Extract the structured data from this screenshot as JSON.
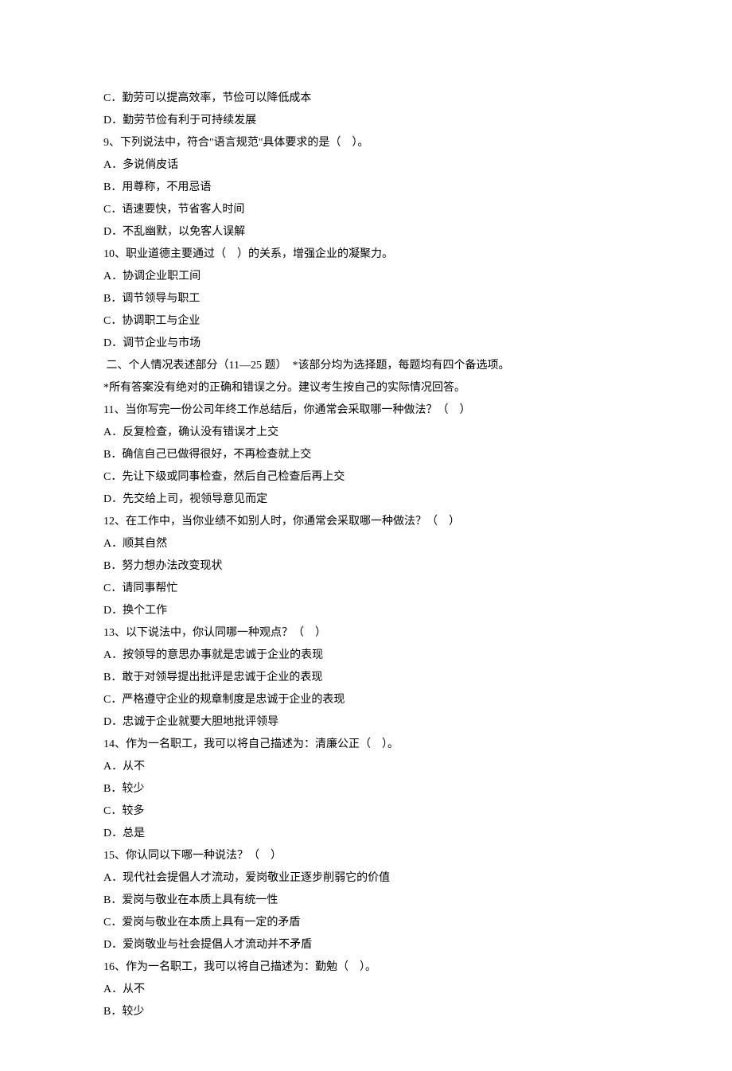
{
  "lines": [
    "C．勤劳可以提高效率，节俭可以降低成本",
    "D．勤劳节俭有利于可持续发展",
    "9、下列说法中，符合\"语言规范\"具体要求的是（    ）。",
    "A．多说俏皮话",
    "B．用尊称，不用忌语",
    "C．语速要快，节省客人时间",
    "D．不乱幽默，以免客人误解",
    "10、职业道德主要通过（    ）的关系，增强企业的凝聚力。",
    "A．协调企业职工间",
    "B．调节领导与职工",
    "C．协调职工与企业",
    "D．调节企业与市场",
    " 二、个人情况表述部分（11—25 题）  *该部分均为选择题，每题均有四个备选项。",
    "*所有答案没有绝对的正确和错误之分。建议考生按自己的实际情况回答。",
    "11、当你写完一份公司年终工作总结后，你通常会采取哪一种做法？（    ）",
    "A．反复检查，确认没有错误才上交",
    "B．确信自己已做得很好，不再检查就上交",
    "C．先让下级或同事检查，然后自己检查后再上交",
    "D．先交给上司，视领导意见而定",
    "12、在工作中，当你业绩不如别人时，你通常会采取哪一种做法？（    ）",
    "A．顺其自然",
    "B．努力想办法改变现状",
    "C．请同事帮忙",
    "D．换个工作",
    "13、以下说法中，你认同哪一种观点？（    ）",
    "A．按领导的意思办事就是忠诚于企业的表现",
    "B．敢于对领导提出批评是忠诚于企业的表现",
    "C．严格遵守企业的规章制度是忠诚于企业的表现",
    "D．忠诚于企业就要大胆地批评领导",
    "14、作为一名职工，我可以将自己描述为：清廉公正（    ）。",
    "A．从不",
    "B．较少",
    "C．较多",
    "D．总是",
    "15、你认同以下哪一种说法？（    ）",
    "A．现代社会提倡人才流动，爱岗敬业正逐步削弱它的价值",
    "B．爱岗与敬业在本质上具有统一性",
    "C．爱岗与敬业在本质上具有一定的矛盾",
    "D．爱岗敬业与社会提倡人才流动并不矛盾",
    "16、作为一名职工，我可以将自己描述为：勤勉（    ）。",
    "A．从不",
    "B．较少"
  ]
}
